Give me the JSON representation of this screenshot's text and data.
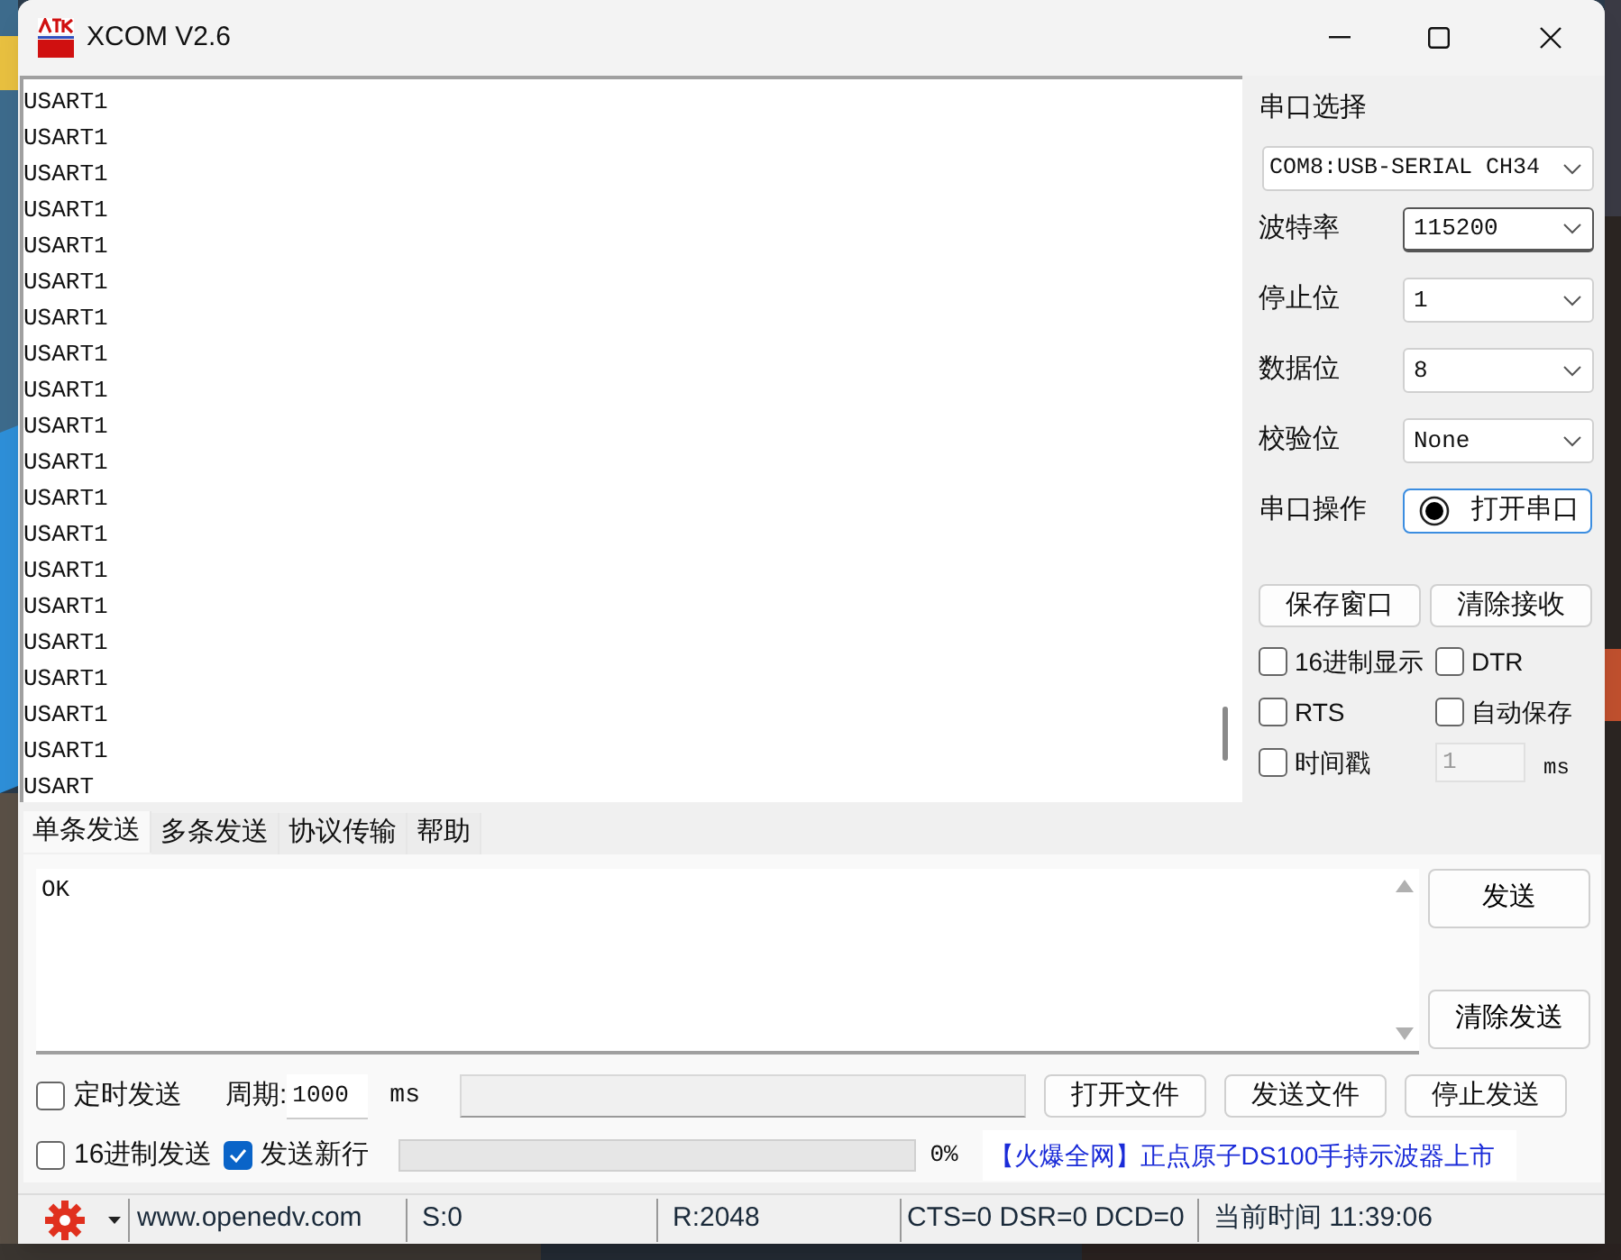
{
  "window": {
    "title": "XCOM V2.6"
  },
  "receive": {
    "lines": [
      "USART1",
      "USART1",
      "USART1",
      "USART1",
      "USART1",
      "USART1",
      "USART1",
      "USART1",
      "USART1",
      "USART1",
      "USART1",
      "USART1",
      "USART1",
      "USART1",
      "USART1",
      "USART1",
      "USART1",
      "USART1",
      "USART1",
      "USART"
    ]
  },
  "serial_settings": {
    "title": "串口选择",
    "port": "COM8:USB-SERIAL CH34",
    "fields": [
      {
        "label": "波特率",
        "value": "115200",
        "focused": true
      },
      {
        "label": "停止位",
        "value": "1",
        "focused": false
      },
      {
        "label": "数据位",
        "value": "8",
        "focused": false
      },
      {
        "label": "校验位",
        "value": "None",
        "focused": false
      }
    ],
    "operation_label": "串口操作",
    "operation_button": "打开串口"
  },
  "actions": [
    "保存窗口",
    "清除接收"
  ],
  "options": [
    {
      "label": "16进制显示",
      "checked": false
    },
    {
      "label": "DTR",
      "checked": false
    },
    {
      "label": "RTS",
      "checked": false
    },
    {
      "label": "自动保存",
      "checked": false
    },
    {
      "label": "时间戳",
      "checked": false
    }
  ],
  "timestamp_interval": {
    "value": "1",
    "unit": "ms",
    "disabled": true
  },
  "tabs": [
    {
      "label": "单条发送",
      "selected": true
    },
    {
      "label": "多条发送",
      "selected": false
    },
    {
      "label": "协议传输",
      "selected": false
    },
    {
      "label": "帮助",
      "selected": false
    }
  ],
  "send": {
    "text": "OK",
    "buttons": [
      "发送",
      "清除发送"
    ]
  },
  "timed_send": {
    "label": "定时发送",
    "checked": false,
    "period_label": "周期:",
    "period": "1000",
    "unit": "ms"
  },
  "hex_send": {
    "label": "16进制发送",
    "checked": false
  },
  "newline": {
    "label": "发送新行",
    "checked": true
  },
  "file_buttons": [
    "打开文件",
    "发送文件",
    "停止发送"
  ],
  "progress": {
    "level": 0,
    "reading": "0%"
  },
  "ad": "【火爆全网】正点原子DS100手持示波器上市",
  "status_bar": {
    "url": "www.openedv.com",
    "sent": "S:0",
    "received": "R:2048",
    "signals": "CTS=0 DSR=0 DCD=0",
    "time": "当前时间 11:39:06"
  }
}
